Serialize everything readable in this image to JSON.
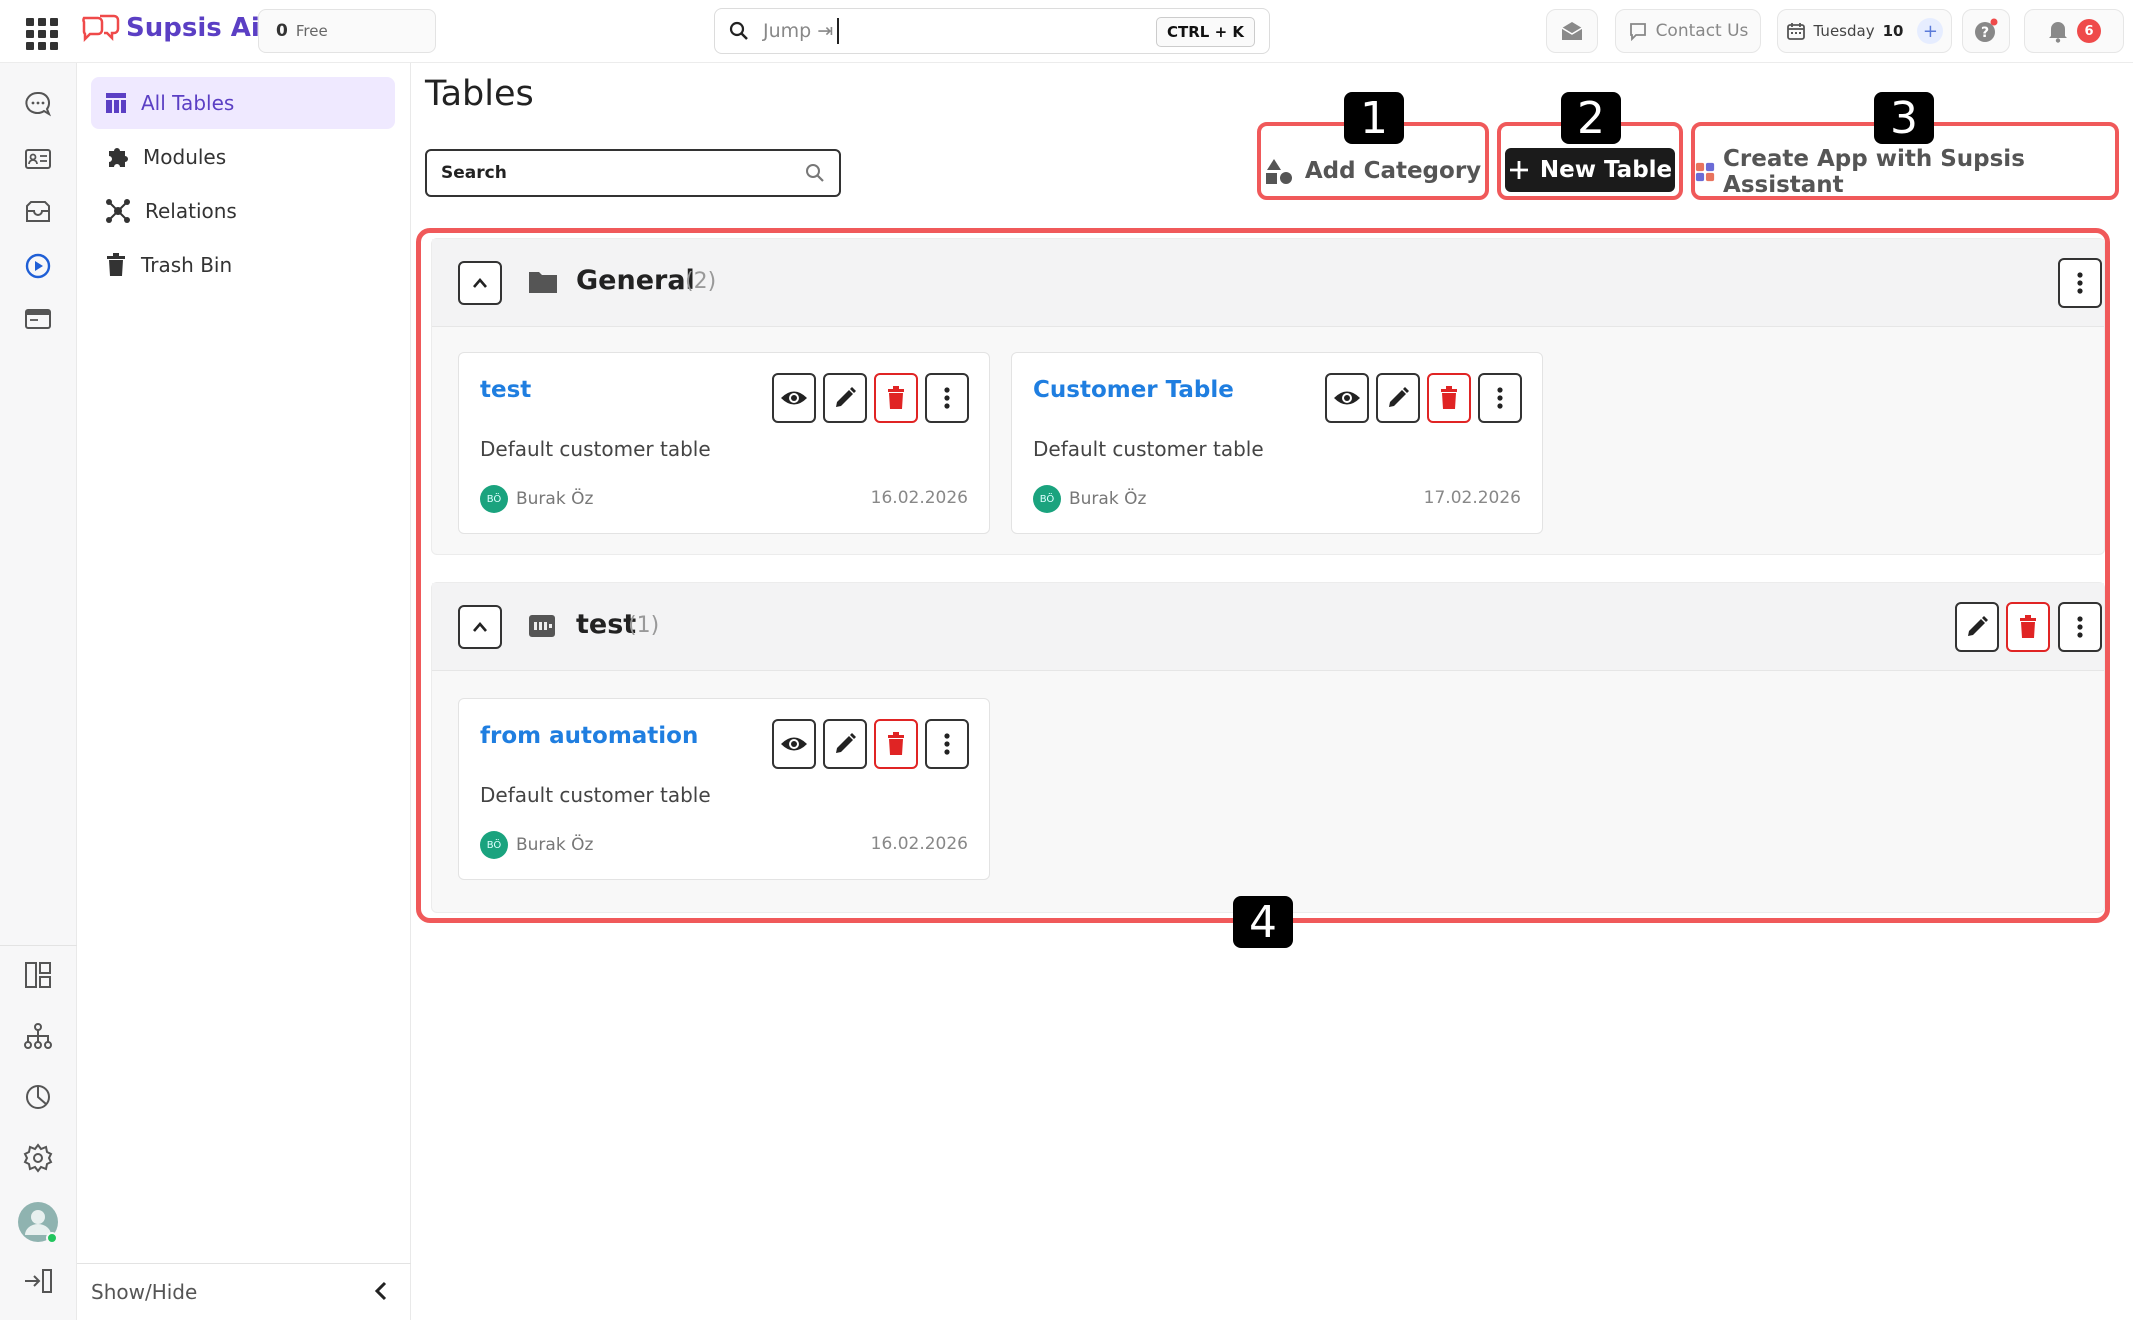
{
  "app": {
    "name": "Supsis Ai"
  },
  "topbar": {
    "credits_value": "0",
    "credits_label": "Free",
    "jump_placeholder": "Jump ⇥",
    "shortcut": "CTRL + K",
    "contact_label": "Contact Us",
    "day_label": "Tuesday",
    "day_number": "10",
    "notifications_count": "6"
  },
  "sidebar": {
    "items": [
      {
        "label": "All Tables",
        "icon": "table-icon",
        "active": true
      },
      {
        "label": "Modules",
        "icon": "puzzle-icon"
      },
      {
        "label": "Relations",
        "icon": "relations-icon"
      },
      {
        "label": "Trash Bin",
        "icon": "trash-icon"
      }
    ],
    "footer_label": "Show/Hide"
  },
  "main": {
    "title": "Tables",
    "search_placeholder": "Search",
    "add_category_label": "Add Category",
    "new_table_label": "New Table",
    "assistant_label": "Create App with Supsis Assistant"
  },
  "badges": [
    "1",
    "2",
    "3",
    "4"
  ],
  "sections": [
    {
      "title": "General",
      "count": "(2)",
      "cards": [
        {
          "title": "test",
          "description": "Default customer table",
          "user_initials": "BÖ",
          "user": "Burak Öz",
          "date": "16.02.2026"
        },
        {
          "title": "Customer Table",
          "description": "Default customer table",
          "user_initials": "BÖ",
          "user": "Burak Öz",
          "date": "17.02.2026"
        }
      ]
    },
    {
      "title": "test",
      "count": "(1)",
      "cards": [
        {
          "title": "from automation",
          "description": "Default customer table",
          "user_initials": "BÖ",
          "user": "Burak Öz",
          "date": "16.02.2026"
        }
      ]
    }
  ],
  "colors": {
    "accent": "#5b3fc4",
    "link": "#1f7ee0",
    "highlight": "#f0595a",
    "danger": "#e02424"
  }
}
